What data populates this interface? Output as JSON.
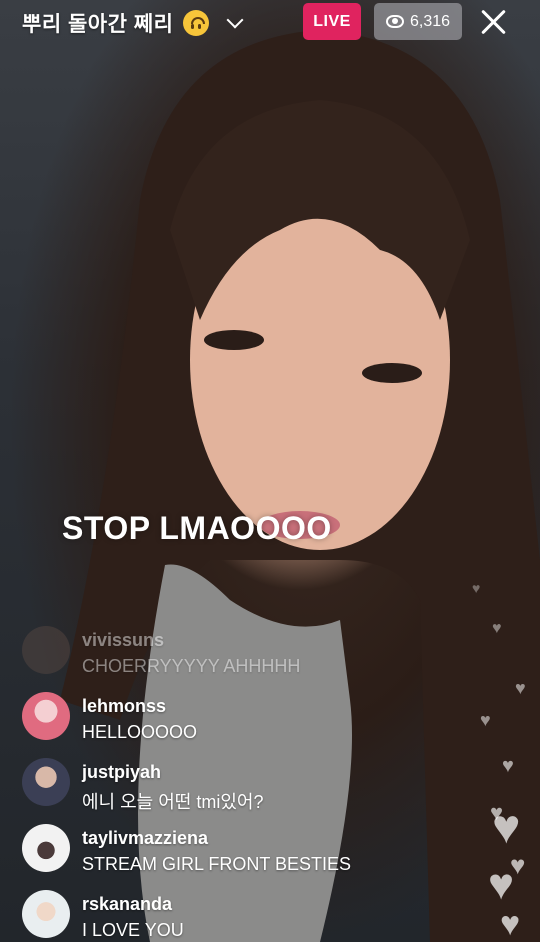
{
  "header": {
    "title": "뿌리 돌아간 쩨리",
    "live_label": "LIVE",
    "viewer_count": "6,316"
  },
  "caption": "STOP LMAOOOO",
  "comments": [
    {
      "user": "vivissuns",
      "text": "CHOERRYYYYY AHHHHH"
    },
    {
      "user": "lehmonss",
      "text": "HELLOOOOO"
    },
    {
      "user": "justpiyah",
      "text": "에니 오늘 어떤 tmi있어?"
    },
    {
      "user": "taylivmazziena",
      "text": "STREAM GIRL FRONT BESTIES"
    },
    {
      "user": "rskananda",
      "text": "I LOVE YOU"
    }
  ],
  "colors": {
    "live_badge": "#e0235f",
    "viewer_badge": "#96969b"
  },
  "icons": {
    "mood": "upside-down-face-icon",
    "dropdown": "chevron-down-icon",
    "viewers": "eye-icon",
    "close": "close-icon",
    "reactions": "heart-icon"
  }
}
